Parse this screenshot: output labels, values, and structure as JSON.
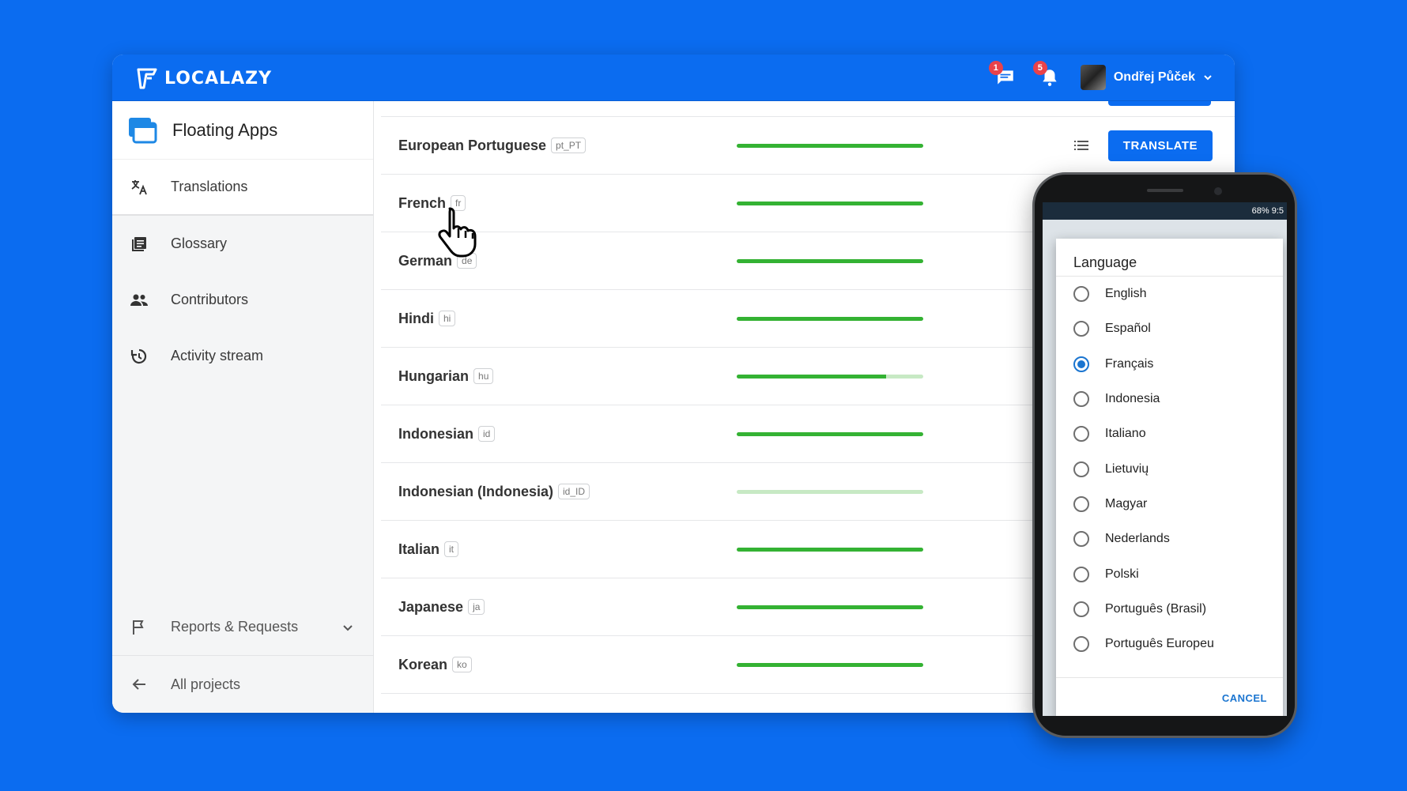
{
  "header": {
    "brand": "LOCALAZY",
    "messages_count": "1",
    "notifications_count": "5",
    "user_name": "Ondřej Půček"
  },
  "sidebar": {
    "project_name": "Floating Apps",
    "items": [
      {
        "label": "Translations",
        "icon": "translate-icon"
      },
      {
        "label": "Glossary",
        "icon": "book-icon"
      },
      {
        "label": "Contributors",
        "icon": "people-icon"
      },
      {
        "label": "Activity stream",
        "icon": "history-icon"
      }
    ],
    "reports_label": "Reports & Requests",
    "all_projects_label": "All projects"
  },
  "languages": [
    {
      "name": "European Portuguese",
      "code": "pt_PT",
      "progress": 1.0
    },
    {
      "name": "French",
      "code": "fr",
      "progress": 1.0
    },
    {
      "name": "German",
      "code": "de",
      "progress": 1.0
    },
    {
      "name": "Hindi",
      "code": "hi",
      "progress": 1.0
    },
    {
      "name": "Hungarian",
      "code": "hu",
      "progress": 0.8
    },
    {
      "name": "Indonesian",
      "code": "id",
      "progress": 1.0
    },
    {
      "name": "Indonesian (Indonesia)",
      "code": "id_ID",
      "progress": 0.0
    },
    {
      "name": "Italian",
      "code": "it",
      "progress": 1.0
    },
    {
      "name": "Japanese",
      "code": "ja",
      "progress": 1.0
    },
    {
      "name": "Korean",
      "code": "ko",
      "progress": 1.0
    }
  ],
  "translate_button": "TRANSLATE",
  "phone": {
    "status": "68% 9:5",
    "dialog_title": "Language",
    "options": [
      "English",
      "Español",
      "Français",
      "Indonesia",
      "Italiano",
      "Lietuvių",
      "Magyar",
      "Nederlands",
      "Polski",
      "Português (Brasil)",
      "Português Europeu"
    ],
    "selected_index": 2,
    "cancel_label": "CANCEL"
  },
  "colors": {
    "brand": "#0b6cf0",
    "progress": "#34b233",
    "progress_track": "#c7e9c4",
    "badge": "#e9424a"
  }
}
